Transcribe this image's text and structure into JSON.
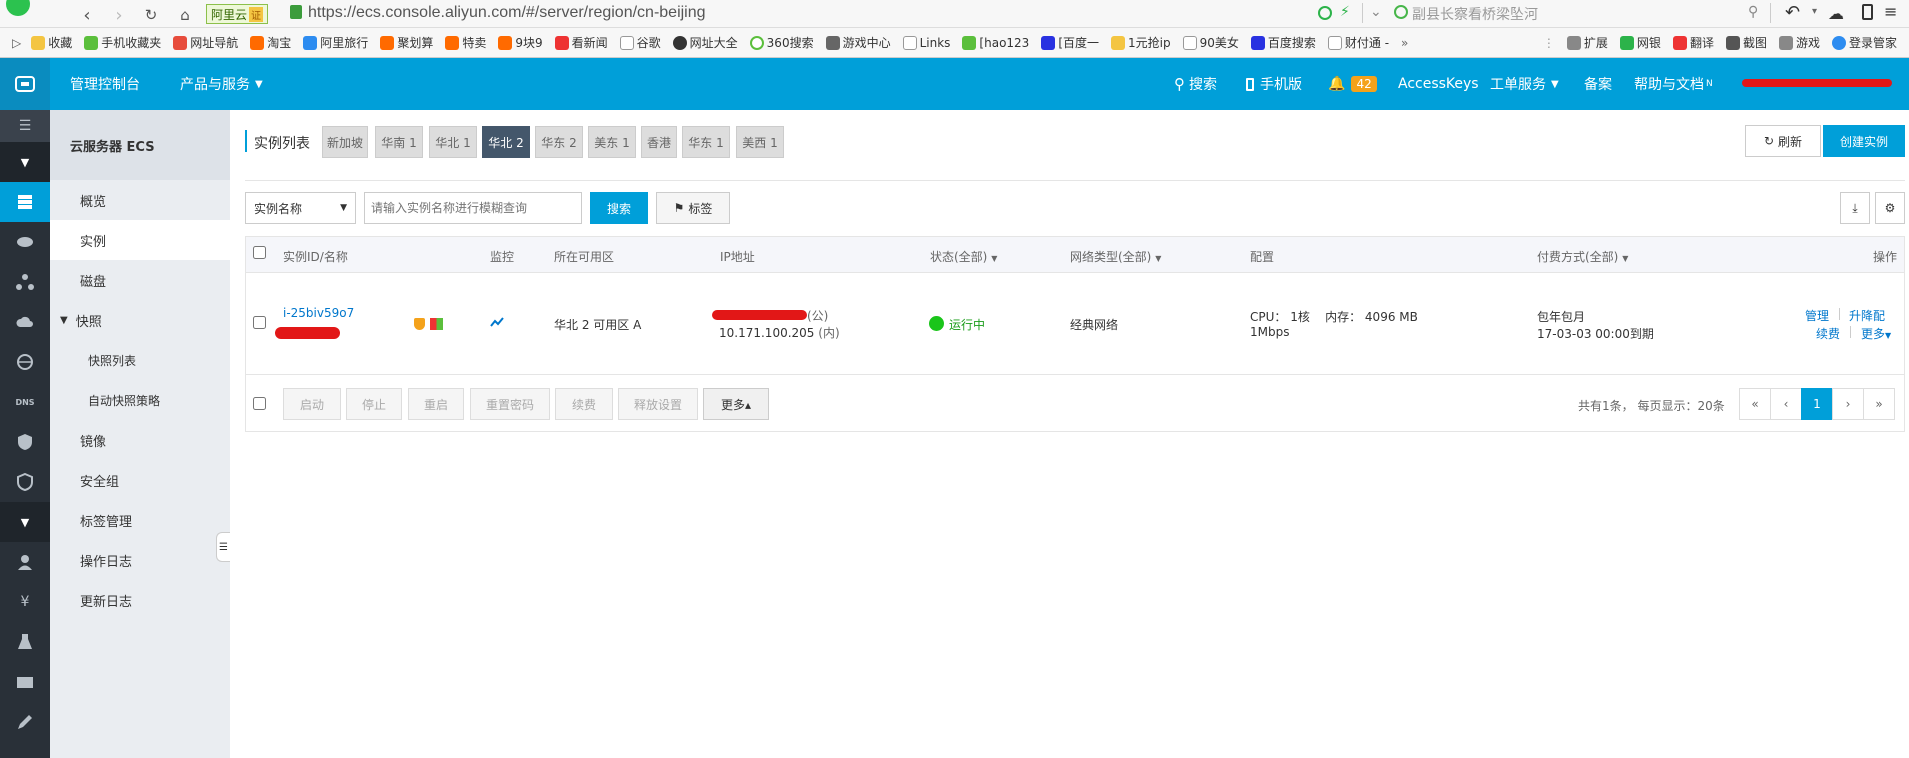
{
  "browser": {
    "brand_badge": "阿里云",
    "cert_badge": "证",
    "url": "https://ecs.console.aliyun.com/#/server/region/cn-beijing",
    "search_text": "副县长察看桥梁坠河"
  },
  "bookmarks": [
    "收藏",
    "手机收藏夹",
    "网址导航",
    "淘宝",
    "阿里旅行",
    "聚划算",
    "特卖",
    "9块9",
    "看新闻",
    "谷歌",
    "网址大全",
    "360搜索",
    "游戏中心",
    "Links",
    "[hao123",
    "[百度一",
    "1元抢ip",
    "90美女",
    "百度搜索",
    "财付通 -",
    "»"
  ],
  "bookmarks_right": [
    "扩展",
    "网银",
    "翻译",
    "截图",
    "游戏",
    "登录管家"
  ],
  "header": {
    "console": "管理控制台",
    "products": "产品与服务",
    "search": "搜索",
    "mobile": "手机版",
    "notif_count": "42",
    "accesskeys": "AccessKeys",
    "tickets": "工单服务",
    "beian": "备案",
    "help": "帮助与文档",
    "help_badge": "N"
  },
  "side": {
    "title": "云服务器 ECS",
    "items": [
      "概览",
      "实例",
      "磁盘",
      "快照",
      "快照列表",
      "自动快照策略",
      "镜像",
      "安全组",
      "标签管理",
      "操作日志",
      "更新日志"
    ]
  },
  "main": {
    "list_title": "实例列表",
    "regions": [
      "新加坡",
      "华南 1",
      "华北 1",
      "华北 2",
      "华东 2",
      "美东 1",
      "香港",
      "华东 1",
      "美西 1"
    ],
    "refresh": "刷新",
    "create": "创建实例",
    "filter_select": "实例名称",
    "search_placeholder": "请输入实例名称进行模糊查询",
    "search_btn": "搜索",
    "tag_btn": "标签"
  },
  "table": {
    "headers": {
      "id": "实例ID/名称",
      "monitor": "监控",
      "zone": "所在可用区",
      "ip": "IP地址",
      "status": "状态(全部)",
      "network": "网络类型(全部)",
      "config": "配置",
      "billing": "付费方式(全部)",
      "ops": "操作"
    },
    "row": {
      "id": "i-25biv59o7",
      "zone": "华北 2 可用区 A",
      "ip_public_suffix": "(公)",
      "ip_private": "10.171.100.205",
      "ip_private_suffix": "(内)",
      "status": "运行中",
      "network": "经典网络",
      "config_line1": "CPU： 1核    内存： 4096 MB",
      "config_line2": "1Mbps",
      "billing_line1": "包年包月",
      "billing_line2": "17-03-03 00:00到期",
      "op_manage": "管理",
      "op_upgrade": "升降配",
      "op_renew": "续费",
      "op_more": "更多"
    }
  },
  "bulk": {
    "buttons": [
      "启动",
      "停止",
      "重启",
      "重置密码",
      "续费",
      "释放设置"
    ],
    "more": "更多▴",
    "summary": "共有1条， 每页显示：20条",
    "pages": [
      "«",
      "‹",
      "1",
      "›",
      "»"
    ]
  },
  "colors": {
    "accent": "#009fd9",
    "dark_strip": "#293038",
    "side_bg": "#eaedf1",
    "running": "#1ac51a"
  }
}
